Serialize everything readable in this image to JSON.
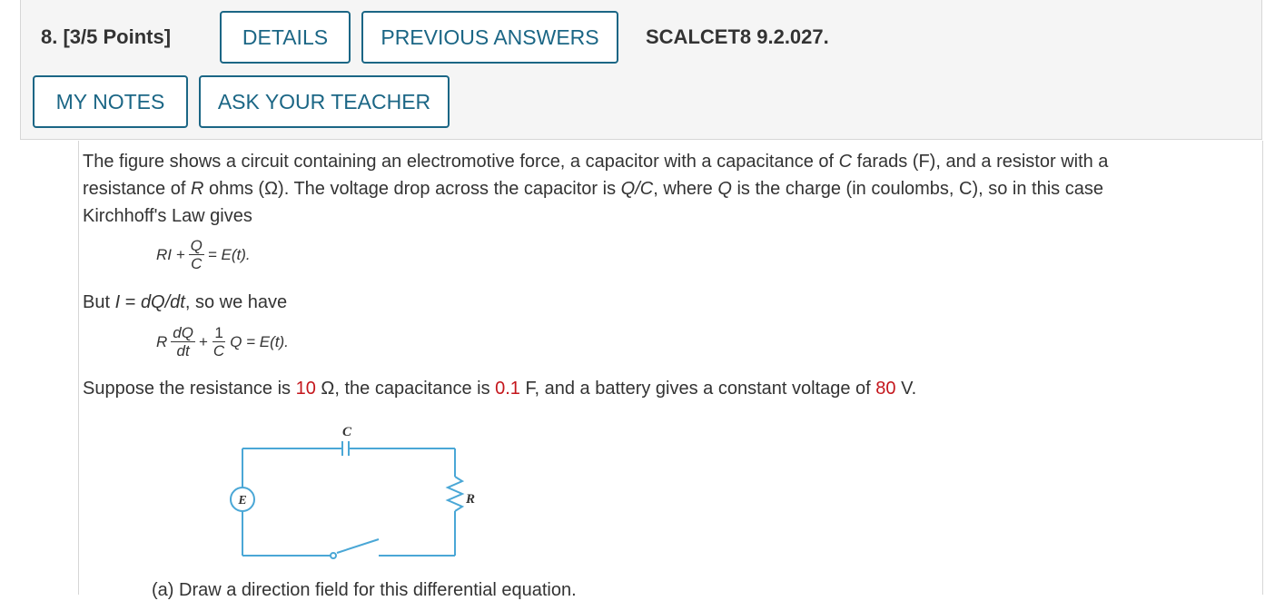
{
  "question": {
    "number": "8.",
    "points": "[3/5 Points]",
    "code": "SCALCET8 9.2.027."
  },
  "buttons": {
    "details": "DETAILS",
    "previous_answers": "PREVIOUS ANSWERS",
    "my_notes": "MY NOTES",
    "ask_teacher": "ASK YOUR TEACHER"
  },
  "colors": {
    "accent": "#1b6685",
    "highlight_red": "#c4161c",
    "circuit_blue": "#4aa7d6"
  },
  "body": {
    "p1_a": "The figure shows a circuit containing an electromotive force, a capacitor with a capacitance of ",
    "p1_C": "C",
    "p1_b": " farads (F), and a resistor with a resistance of ",
    "p1_R": "R",
    "p1_c": " ohms (Ω). The voltage drop across the capacitor is ",
    "p1_QC": "Q/C",
    "p1_d": ", where ",
    "p1_Q": "Q",
    "p1_e": " is the charge (in coulombs, C), so in this case Kirchhoff's Law gives",
    "eq1_left": "RI +",
    "eq1_num": "Q",
    "eq1_den": "C",
    "eq1_right": "= E(t).",
    "p2_a": "But ",
    "p2_I": "I",
    "p2_b": " = ",
    "p2_dQdt": "dQ/dt",
    "p2_c": ", so we have",
    "eq2_R": "R",
    "eq2_num1": "dQ",
    "eq2_den1": "dt",
    "eq2_plus": "+",
    "eq2_num2": "1",
    "eq2_den2": "C",
    "eq2_right": "Q = E(t).",
    "p3_a": "Suppose the resistance is ",
    "p3_r": "10",
    "p3_b": " Ω, the capacitance is ",
    "p3_c_val": "0.1",
    "p3_c": " F, and a battery gives a constant voltage of ",
    "p3_v": "80",
    "p3_d": " V.",
    "cut_text": "(a) Draw a direction field for this differential equation."
  },
  "circuit": {
    "label_C": "C",
    "label_R": "R",
    "label_E": "E"
  }
}
